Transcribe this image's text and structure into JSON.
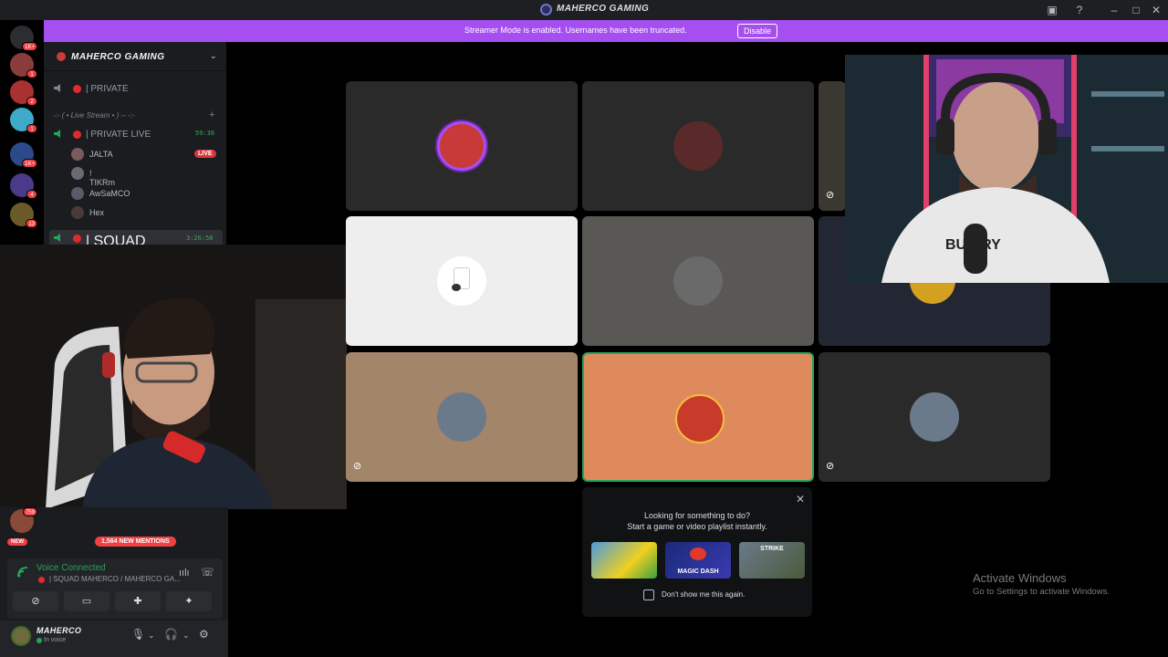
{
  "window": {
    "title": "MAHERCO GAMING"
  },
  "banner": {
    "message": "Streamer Mode is enabled. Usernames have been truncated.",
    "disable_label": "Disable"
  },
  "server_badges": [
    "1K+",
    "1",
    "2",
    "1",
    "1K+",
    "4",
    "13"
  ],
  "guild": {
    "name": "MAHERCO GAMING",
    "channels": {
      "private": "| PRIVATE",
      "category": "-:- ( • Live Stream • ) -- -:-",
      "private_live": "| PRIVATE LIVE",
      "private_live_timer": "59:36",
      "live_badge": "LIVE",
      "users": [
        "JALTA",
        "! TIKRm",
        "AwSaMCO",
        "Hex"
      ],
      "squad": "| SQUAD MAHERCO",
      "squad_timer": "3:26:58"
    }
  },
  "notifications": {
    "mentions": "1,564 NEW MENTIONS",
    "new_badge": "NEW",
    "server_badge": "759"
  },
  "voice": {
    "status": "Voice Connected",
    "channel": "| SQUAD MAHERCO / MAHERCO GA..."
  },
  "user": {
    "name": "MAHERCO",
    "status": "In voice"
  },
  "activity": {
    "line1": "Looking for something to do?",
    "line2": "Start a game or video playlist instantly.",
    "games": [
      "",
      "MAGIC DASH",
      "STRIKE"
    ],
    "checkbox_label": "Don't show me this again."
  },
  "watermark": {
    "title": "Activate Windows",
    "subtitle": "Go to Settings to activate Windows."
  },
  "colors": {
    "accent": "#a64ff0",
    "voice_green": "#23a55a",
    "danger": "#f23f43"
  }
}
